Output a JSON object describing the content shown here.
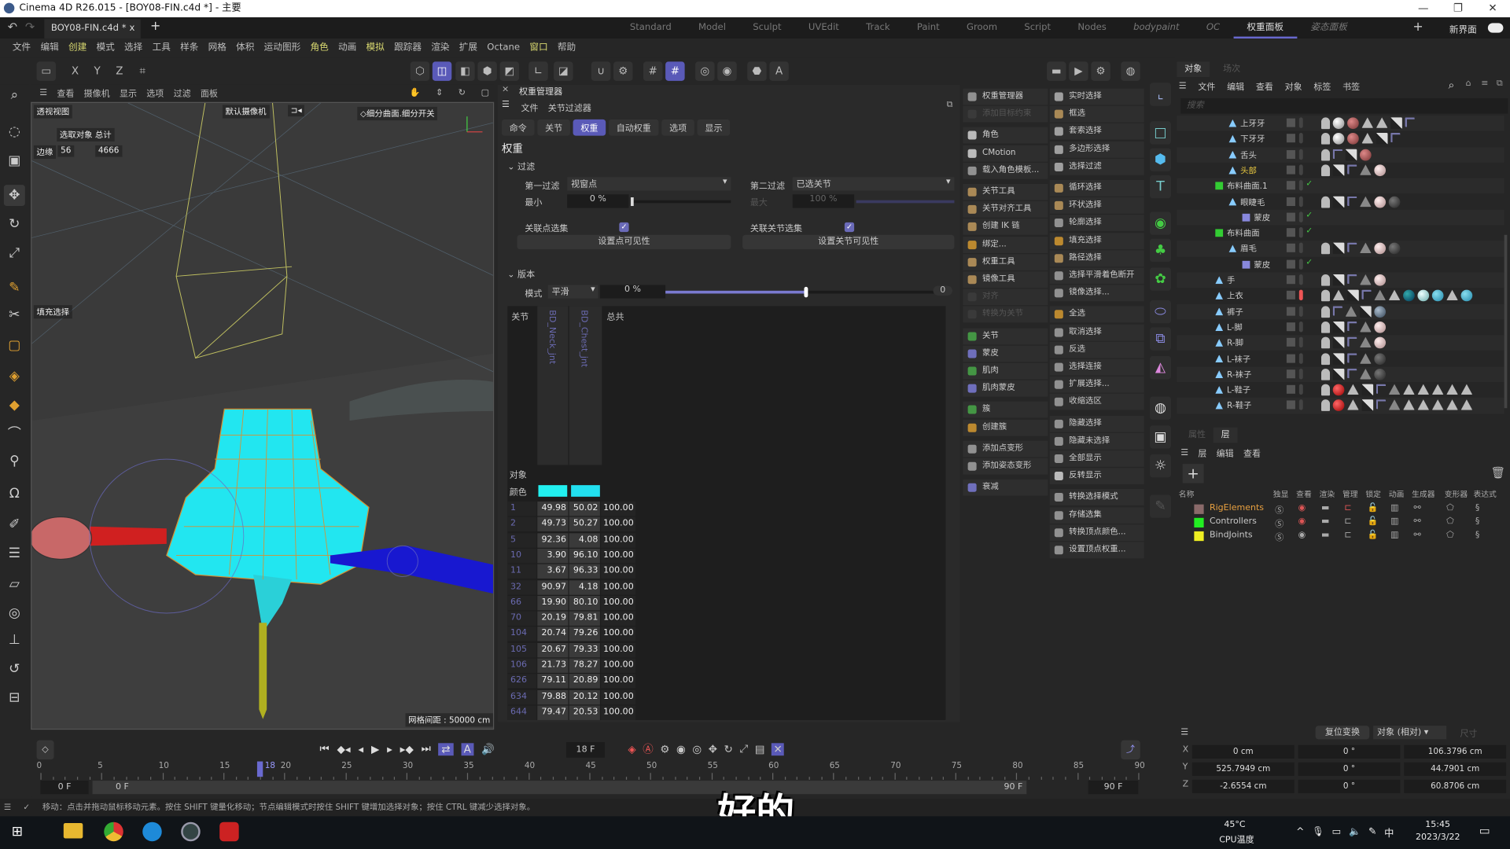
{
  "window": {
    "title": "Cinema 4D R26.015 - [BOY08-FIN.c4d *] - 主要",
    "controls": [
      "—",
      "❐",
      "✕"
    ]
  },
  "tabbar": {
    "file_tab": "BOY08-FIN.c4d *",
    "close": "x",
    "add": "+",
    "layouts": [
      "Standard",
      "Model",
      "Sculpt",
      "UVEdit",
      "Track",
      "Paint",
      "Groom",
      "Script",
      "Nodes",
      "bodypaint",
      "OC",
      "权重面板",
      "姿态面板"
    ],
    "active_layout": "权重面板",
    "new_ui": "新界面"
  },
  "menubar": [
    "文件",
    "编辑",
    "创建",
    "模式",
    "选择",
    "工具",
    "样条",
    "网格",
    "体积",
    "运动图形",
    "角色",
    "动画",
    "模拟",
    "跟踪器",
    "渲染",
    "扩展",
    "Octane",
    "窗口",
    "帮助"
  ],
  "menubar_highlight": [
    "创建",
    "角色",
    "模拟",
    "窗口"
  ],
  "toolbar": {
    "axes": [
      "X",
      "Y",
      "Z"
    ]
  },
  "viewport": {
    "menu": [
      "查看",
      "摄像机",
      "显示",
      "选项",
      "过滤",
      "面板"
    ],
    "view_name": "透视视图",
    "camera": "默认摄像机",
    "subdiv": "◇细分曲面.细分开关",
    "stats_header": "选取对象 总计",
    "stats_label": "边缘",
    "stats_selected": "56",
    "stats_total": "4666",
    "tag_label": "填充选择",
    "grid_spacing": "网格间距 : 50000 cm",
    "mesh_color": "#22e6f0"
  },
  "weight_manager": {
    "title": "权重管理器",
    "menu": [
      "文件",
      "关节过滤器"
    ],
    "tabs": [
      "命令",
      "关节",
      "权重",
      "自动权重",
      "选项",
      "显示"
    ],
    "active_tab": "权重",
    "section": "权重",
    "filter_group": "过滤",
    "filter1_label": "第一过滤",
    "filter1_value": "视窗点",
    "filter2_label": "第二过滤",
    "filter2_value": "已选关节",
    "min_label": "最小",
    "min_value": "0 %",
    "max_label": "最大",
    "max_value": "100 %",
    "link_points_label": "关联点选集",
    "link_points_checked": true,
    "link_joints_label": "关联关节选集",
    "link_joints_checked": true,
    "set_point_vis": "设置点可见性",
    "set_joint_vis": "设置关节可见性",
    "version_group": "版本",
    "mode_label": "模式",
    "mode_value": "平滑",
    "mode_percent": "0 %",
    "mode_slider": 0.5,
    "mode_end": "0",
    "table": {
      "headers": [
        "关节",
        "BD_Neck_jnt",
        "BD_Chest_jnt",
        "总共"
      ],
      "object_label": "对象",
      "color_label": "颜色",
      "joint_colors": [
        "#22f0f0",
        "#22e0f0"
      ],
      "rows": [
        [
          "1",
          "49.98",
          "50.02",
          "100.00"
        ],
        [
          "2",
          "49.73",
          "50.27",
          "100.00"
        ],
        [
          "5",
          "92.36",
          "4.08",
          "100.00"
        ],
        [
          "10",
          "3.90",
          "96.10",
          "100.00"
        ],
        [
          "11",
          "3.67",
          "96.33",
          "100.00"
        ],
        [
          "32",
          "90.97",
          "4.18",
          "100.00"
        ],
        [
          "66",
          "19.90",
          "80.10",
          "100.00"
        ],
        [
          "70",
          "20.19",
          "79.81",
          "100.00"
        ],
        [
          "104",
          "20.74",
          "79.26",
          "100.00"
        ],
        [
          "105",
          "20.67",
          "79.33",
          "100.00"
        ],
        [
          "106",
          "21.73",
          "78.27",
          "100.00"
        ],
        [
          "626",
          "79.11",
          "20.89",
          "100.00"
        ],
        [
          "634",
          "79.88",
          "20.12",
          "100.00"
        ],
        [
          "644",
          "79.47",
          "20.53",
          "100.00"
        ]
      ]
    }
  },
  "commands_col1": [
    {
      "label": "权重管理器",
      "color": "#aaa"
    },
    {
      "label": "添加目标约束",
      "disabled": true,
      "color": "#555"
    },
    {
      "label": "角色",
      "color": "#ddd"
    },
    {
      "label": "CMotion",
      "color": "#ddd"
    },
    {
      "label": "载入角色模板...",
      "color": "#aaa"
    },
    {
      "label": "关节工具",
      "color": "#c9a060"
    },
    {
      "label": "关节对齐工具",
      "color": "#c9a060"
    },
    {
      "label": "创建 IK 链",
      "color": "#c9a060"
    },
    {
      "label": "绑定...",
      "color": "#e0a030"
    },
    {
      "label": "权重工具",
      "color": "#c9a060"
    },
    {
      "label": "镜像工具",
      "color": "#c9a060"
    },
    {
      "label": "对齐",
      "disabled": true,
      "color": "#555"
    },
    {
      "label": "转换为关节",
      "disabled": true,
      "color": "#555"
    },
    {
      "label": "关节",
      "color": "#4ab04a"
    },
    {
      "label": "蒙皮",
      "color": "#8080e0"
    },
    {
      "label": "肌肉",
      "color": "#4ab04a"
    },
    {
      "label": "肌肉蒙皮",
      "color": "#8080e0"
    },
    {
      "label": "簇",
      "color": "#4ab04a"
    },
    {
      "label": "创建簇",
      "color": "#e0a030"
    },
    {
      "label": "添加点变形",
      "color": "#aaa"
    },
    {
      "label": "添加姿态变形",
      "color": "#aaa"
    },
    {
      "label": "衰减",
      "color": "#8080e0"
    }
  ],
  "commands_col2": [
    {
      "label": "实时选择"
    },
    {
      "label": "框选"
    },
    {
      "label": "套索选择"
    },
    {
      "label": "多边形选择"
    },
    {
      "label": "选择过滤"
    },
    {
      "label": "循环选择"
    },
    {
      "label": "环状选择"
    },
    {
      "label": "轮廓选择"
    },
    {
      "label": "填充选择"
    },
    {
      "label": "路径选择"
    },
    {
      "label": "选择平滑着色断开"
    },
    {
      "label": "镜像选择..."
    },
    {
      "label": "全选"
    },
    {
      "label": "取消选择"
    },
    {
      "label": "反选"
    },
    {
      "label": "选择连接"
    },
    {
      "label": "扩展选择..."
    },
    {
      "label": "收缩选区"
    },
    {
      "label": "隐藏选择"
    },
    {
      "label": "隐藏未选择"
    },
    {
      "label": "全部显示"
    },
    {
      "label": "反转显示"
    },
    {
      "label": "转换选择模式"
    },
    {
      "label": "存储选集"
    },
    {
      "label": "转换顶点颜色..."
    },
    {
      "label": "设置顶点权重..."
    }
  ],
  "object_manager": {
    "tabs": [
      "对象",
      "场次"
    ],
    "menu": [
      "文件",
      "编辑",
      "查看",
      "对象",
      "标签",
      "书签"
    ],
    "search_placeholder": "搜索",
    "rows": [
      {
        "name": "上牙牙",
        "indent": 2,
        "icon": "poly",
        "tags": [
          "lock",
          "mw",
          "mr",
          "tri",
          "tri",
          "chk",
          "phong"
        ]
      },
      {
        "name": "下牙牙",
        "indent": 2,
        "icon": "poly",
        "tags": [
          "lock",
          "mw",
          "mr",
          "tri",
          "chk",
          "phong"
        ]
      },
      {
        "name": "舌头",
        "indent": 2,
        "icon": "poly",
        "tags": [
          "lock",
          "phong",
          "chk",
          "mr"
        ]
      },
      {
        "name": "头部",
        "indent": 2,
        "icon": "poly",
        "color": "#e8c840",
        "tags": [
          "lock",
          "chk",
          "phong",
          "trio",
          "mp"
        ]
      },
      {
        "name": "布料曲面.1",
        "indent": 1,
        "icon": "cloth",
        "check": true,
        "tags": []
      },
      {
        "name": "眼睫毛",
        "indent": 2,
        "icon": "poly",
        "tags": [
          "lock",
          "chk",
          "phong",
          "trio",
          "mp",
          "md"
        ]
      },
      {
        "name": "蒙皮",
        "indent": 3,
        "icon": "skin",
        "check": true,
        "tags": []
      },
      {
        "name": "布料曲面",
        "indent": 1,
        "icon": "cloth",
        "check": true,
        "tags": []
      },
      {
        "name": "眉毛",
        "indent": 2,
        "icon": "poly",
        "tags": [
          "lock",
          "chk",
          "phong",
          "trio",
          "mp",
          "md"
        ]
      },
      {
        "name": "蒙皮",
        "indent": 3,
        "icon": "skin",
        "check": true,
        "tags": []
      },
      {
        "name": "手",
        "indent": 1,
        "icon": "poly",
        "tags": [
          "lock",
          "chk",
          "phong",
          "trio",
          "mp"
        ]
      },
      {
        "name": "上衣",
        "indent": 1,
        "icon": "poly",
        "red": true,
        "tags": [
          "lock",
          "tri",
          "chk",
          "phong",
          "trio",
          "tri",
          "mt",
          "mc",
          "mb",
          "tri",
          "mb"
        ]
      },
      {
        "name": "裤子",
        "indent": 1,
        "icon": "poly",
        "tags": [
          "lock",
          "phong",
          "trio",
          "chk",
          "mj"
        ]
      },
      {
        "name": "L-脚",
        "indent": 1,
        "icon": "poly",
        "tags": [
          "lock",
          "chk",
          "phong",
          "trio",
          "mp"
        ]
      },
      {
        "name": "R-脚",
        "indent": 1,
        "icon": "poly",
        "tags": [
          "lock",
          "chk",
          "phong",
          "trio",
          "mp"
        ]
      },
      {
        "name": "L-袜子",
        "indent": 1,
        "icon": "poly",
        "tags": [
          "lock",
          "chk",
          "phong",
          "trio",
          "md"
        ]
      },
      {
        "name": "R-袜子",
        "indent": 1,
        "icon": "poly",
        "tags": [
          "lock",
          "chk",
          "phong",
          "trio",
          "md"
        ]
      },
      {
        "name": "L-鞋子",
        "indent": 1,
        "icon": "poly",
        "tags": [
          "lock",
          "mred",
          "tri",
          "chk",
          "phong",
          "trio",
          "tri",
          "tri",
          "tri",
          "tri",
          "tri"
        ]
      },
      {
        "name": "R-鞋子",
        "indent": 1,
        "icon": "poly",
        "tags": [
          "lock",
          "mred",
          "tri",
          "chk",
          "phong",
          "trio",
          "tri",
          "tri",
          "tri",
          "tri",
          "tri"
        ]
      }
    ]
  },
  "layers": {
    "tabs": [
      "属性",
      "层"
    ],
    "active_tab": "层",
    "menu": [
      "层",
      "编辑",
      "查看"
    ],
    "columns": [
      "名称",
      "独显",
      "查看",
      "渲染",
      "管理",
      "锁定",
      "动画",
      "生成器",
      "变形器",
      "表达式"
    ],
    "rows": [
      {
        "name": "RigElements",
        "color": "#8a6a6a",
        "name_color": "#e8a040"
      },
      {
        "name": "Controllers",
        "color": "#22ee22",
        "name_color": "#c8c8c8"
      },
      {
        "name": "BindJoints",
        "color": "#eeee22",
        "name_color": "#c8c8c8"
      }
    ]
  },
  "coordinates": {
    "reset_button": "复位变换",
    "mode": "对象 (相对)",
    "size_mode": "尺寸",
    "rows": [
      {
        "axis": "X",
        "pos": "0 cm",
        "rot": "0 °",
        "size": "106.3796 cm"
      },
      {
        "axis": "Y",
        "pos": "525.7949 cm",
        "rot": "0 °",
        "size": "44.7901 cm"
      },
      {
        "axis": "Z",
        "pos": "-2.6554 cm",
        "rot": "0 °",
        "size": "60.8706 cm"
      }
    ]
  },
  "timeline": {
    "current_frame": "18 F",
    "current": 18,
    "start": 0,
    "end": 90,
    "ticks": [
      "0",
      "5",
      "10",
      "15",
      "20",
      "25",
      "30",
      "35",
      "40",
      "45",
      "50",
      "55",
      "60",
      "65",
      "70",
      "75",
      "80",
      "85",
      "90"
    ],
    "marker": "18",
    "range_start": "0 F",
    "range_start2": "0 F",
    "range_end": "90 F",
    "range_end2": "90 F"
  },
  "status": "移动：点击并拖动鼠标移动元素。按住 SHIFT 键量化移动；节点编辑模式时按住 SHIFT 键增加选择对象；按住 CTRL 键减少选择对象。",
  "subtitle": "好的",
  "taskbar": {
    "temp": "45°C",
    "temp_label": "CPU温度",
    "time": "15:45",
    "date": "2023/3/22",
    "ime": "中"
  }
}
